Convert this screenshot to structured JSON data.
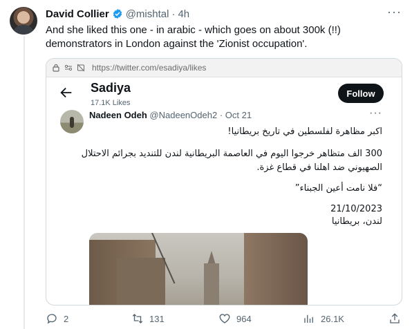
{
  "tweet": {
    "author_name": "David Collier",
    "handle": "@mishtal",
    "separator": "·",
    "time": "4h",
    "text": "And she liked this one - in arabic - which goes on about 300k (!!) demonstrators in London against the 'Zionist occupation'."
  },
  "browser": {
    "url": "https://twitter.com/esadiya/likes"
  },
  "profile": {
    "name": "Sadiya",
    "likes": "17.1K Likes",
    "follow_label": "Follow"
  },
  "inner_tweet": {
    "author_name": "Nadeen Odeh",
    "handle": "@NadeenOdeh2",
    "separator": "·",
    "date": "Oct 21",
    "line1": "اكبر مظاهرة لفلسطين في تاريخ بريطانيا!",
    "line2": "300 الف متظاهر خرجوا اليوم في العاصمة البريطانية لندن للتنديد بجرائم الاحتلال",
    "line3": "الصهيوني ضد اهلنا في قطاع غزة.",
    "line4": "“فلا نامت أعين الجبناء”",
    "line5": "21/10/2023",
    "line6": "لندن، بريطانيا"
  },
  "actions": {
    "replies": "2",
    "retweets": "131",
    "likes": "964",
    "views": "26.1K"
  },
  "colors": {
    "verified": "#1d9bf0",
    "muted": "#536471",
    "follow_bg": "#0f1419"
  }
}
